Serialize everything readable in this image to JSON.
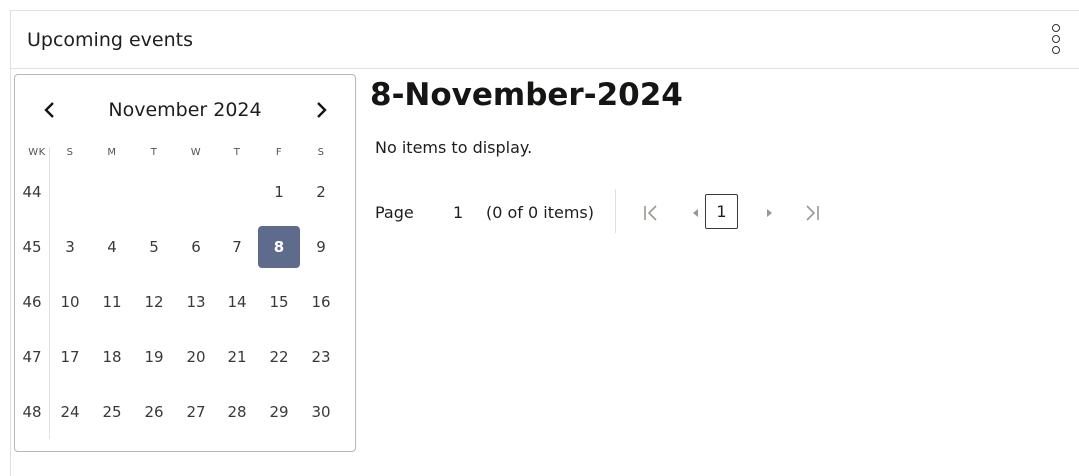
{
  "header": {
    "title": "Upcoming events",
    "menu_icon": "kebab-menu-icon"
  },
  "calendar": {
    "month_label": "November 2024",
    "prev_icon": "chevron-left-icon",
    "next_icon": "chevron-right-icon",
    "weekday_headers": [
      "WK",
      "S",
      "M",
      "T",
      "W",
      "T",
      "F",
      "S"
    ],
    "weeks": [
      {
        "wk": "44",
        "days": [
          "",
          "",
          "",
          "",
          "",
          "1",
          "2"
        ]
      },
      {
        "wk": "45",
        "days": [
          "3",
          "4",
          "5",
          "6",
          "7",
          "8",
          "9"
        ]
      },
      {
        "wk": "46",
        "days": [
          "10",
          "11",
          "12",
          "13",
          "14",
          "15",
          "16"
        ]
      },
      {
        "wk": "47",
        "days": [
          "17",
          "18",
          "19",
          "20",
          "21",
          "22",
          "23"
        ]
      },
      {
        "wk": "48",
        "days": [
          "24",
          "25",
          "26",
          "27",
          "28",
          "29",
          "30"
        ]
      }
    ],
    "selected_day": "8",
    "selected_color": "#5e6b8c"
  },
  "events": {
    "date_title": "8-November-2024",
    "empty_text": "No items to display."
  },
  "pager": {
    "page_label": "Page",
    "page_value": "1",
    "count_text": "(0 of 0 items)",
    "current_page": "1",
    "icons": [
      "first-page-icon",
      "prev-page-icon",
      "next-page-icon",
      "last-page-icon"
    ]
  }
}
